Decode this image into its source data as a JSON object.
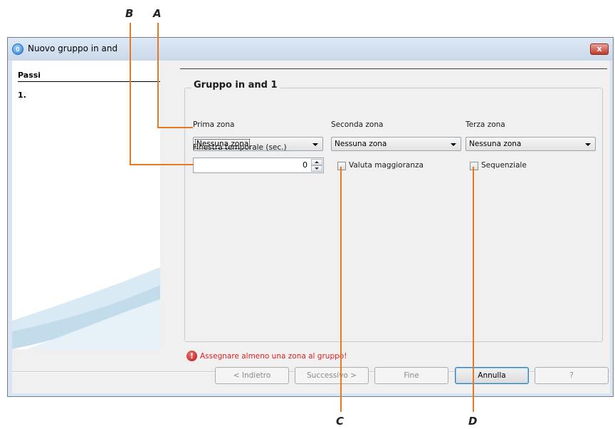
{
  "callouts": {
    "a": "A",
    "b": "B",
    "c": "C",
    "d": "D"
  },
  "window": {
    "title": "Nuovo gruppo in and",
    "close_label": "x"
  },
  "steps": {
    "title": "Passi",
    "items": [
      "1."
    ]
  },
  "group": {
    "title": "Gruppo in and 1",
    "prima_zona": {
      "label": "Prima zona",
      "value": "Nessuna zona"
    },
    "seconda_zona": {
      "label": "Seconda zona",
      "value": "Nessuna zona"
    },
    "terza_zona": {
      "label": "Terza zona",
      "value": "Nessuna zona"
    },
    "finestra": {
      "label": "Finestra temporale (sec.)",
      "value": "0"
    },
    "valuta": {
      "label": "Valuta maggioranza",
      "checked": false
    },
    "sequenziale": {
      "label": "Sequenziale",
      "checked": false
    }
  },
  "error": {
    "icon": "!",
    "message": "Assegnare almeno una zona al gruppo!"
  },
  "buttons": {
    "back": "< Indietro",
    "next": "Successivo >",
    "finish": "Fine",
    "cancel": "Annulla",
    "help": "?"
  },
  "colors": {
    "callout_line": "#e87722",
    "error_text": "#e02020"
  }
}
